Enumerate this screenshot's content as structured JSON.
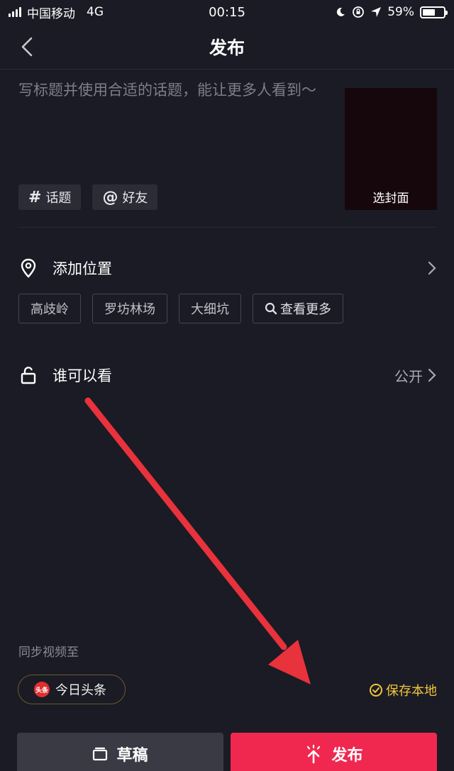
{
  "status_bar": {
    "carrier": "中国移动",
    "network": "4G",
    "time": "00:15",
    "battery_percent": "59%",
    "battery_level": 0.59
  },
  "nav": {
    "title": "发布",
    "back_icon": "chevron-left-icon"
  },
  "caption": {
    "placeholder": "写标题并使用合适的话题，能让更多人看到～"
  },
  "cover": {
    "label": "选封面"
  },
  "chips": [
    {
      "icon": "#",
      "label": "话题"
    },
    {
      "icon": "@",
      "label": "好友"
    }
  ],
  "location": {
    "label": "添加位置",
    "icon": "location-pin-icon",
    "tags": [
      "高歧岭",
      "罗坊林场",
      "大细坑"
    ],
    "more_label": "查看更多"
  },
  "visibility": {
    "label": "谁可以看",
    "icon": "unlock-icon",
    "value": "公开"
  },
  "sync": {
    "label": "同步视频至",
    "toutiao_logo": "头条",
    "toutiao_label": "今日头条",
    "save_local_label": "保存本地"
  },
  "buttons": {
    "draft_label": "草稿",
    "publish_label": "发布"
  },
  "colors": {
    "background": "#1a1b24",
    "publish": "#f0284f",
    "draft": "#393a44",
    "save_local": "#f3c43a",
    "annotation_arrow": "#e8323c"
  }
}
